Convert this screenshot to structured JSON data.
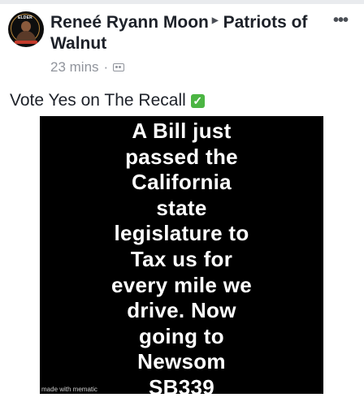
{
  "post": {
    "author": "Reneé Ryann Moon",
    "group": "Patriots of Walnut",
    "time": "23 mins",
    "meta_separator": "·",
    "text": "Vote Yes on The Recall",
    "more_glyph": "•••",
    "check_glyph": "✓"
  },
  "image": {
    "lines": [
      "A Bill just",
      "passed the",
      "California",
      "state",
      "legislature to",
      "Tax us for",
      "every mile we",
      "drive. Now",
      "going to",
      "Newsom",
      "SB339"
    ],
    "watermark": "made with mematic"
  },
  "avatar": {
    "top_text": "ELDER"
  },
  "colors": {
    "text": "#1d2129",
    "meta": "#90949c",
    "image_bg": "#000000",
    "check": "#4bb543"
  }
}
